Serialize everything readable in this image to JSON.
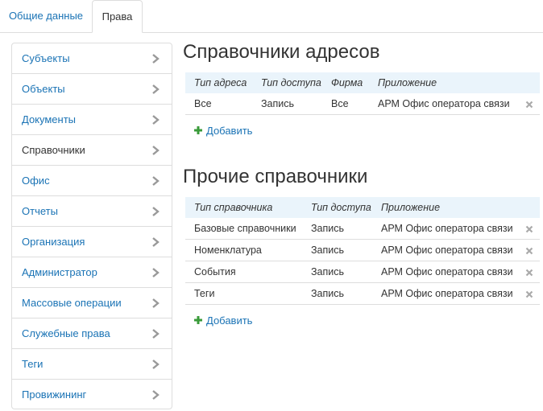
{
  "tabs": [
    {
      "label": "Общие данные",
      "active": false
    },
    {
      "label": "Права",
      "active": true
    }
  ],
  "sidebar": {
    "items": [
      {
        "label": "Субъекты"
      },
      {
        "label": "Объекты"
      },
      {
        "label": "Документы"
      },
      {
        "label": "Справочники",
        "active": true
      },
      {
        "label": "Офис"
      },
      {
        "label": "Отчеты"
      },
      {
        "label": "Организация"
      },
      {
        "label": "Администратор"
      },
      {
        "label": "Массовые операции"
      },
      {
        "label": "Служебные права"
      },
      {
        "label": "Теги"
      },
      {
        "label": "Провижининг"
      }
    ]
  },
  "address_section": {
    "title": "Справочники адресов",
    "columns": [
      "Тип адреса",
      "Тип доступа",
      "Фирма",
      "Приложение"
    ],
    "rows": [
      [
        "Все",
        "Запись",
        "Все",
        "АРМ Офис оператора связи"
      ]
    ],
    "add_label": "Добавить"
  },
  "other_section": {
    "title": "Прочие справочники",
    "columns": [
      "Тип справочника",
      "Тип доступа",
      "Приложение"
    ],
    "rows": [
      [
        "Базовые справочники",
        "Запись",
        "АРМ Офис оператора связи"
      ],
      [
        "Номенклатура",
        "Запись",
        "АРМ Офис оператора связи"
      ],
      [
        "События",
        "Запись",
        "АРМ Офис оператора связи"
      ],
      [
        "Теги",
        "Запись",
        "АРМ Офис оператора связи"
      ]
    ],
    "add_label": "Добавить"
  },
  "colors": {
    "link": "#1a73b5",
    "header_bg": "#eaf4fb",
    "add_icon": "#3a9b3a",
    "chevron": "#999999",
    "close_icon": "#aaaaaa"
  },
  "icons": {
    "chevron": "chevron-right-icon",
    "remove": "close-icon",
    "add": "plus-icon"
  }
}
